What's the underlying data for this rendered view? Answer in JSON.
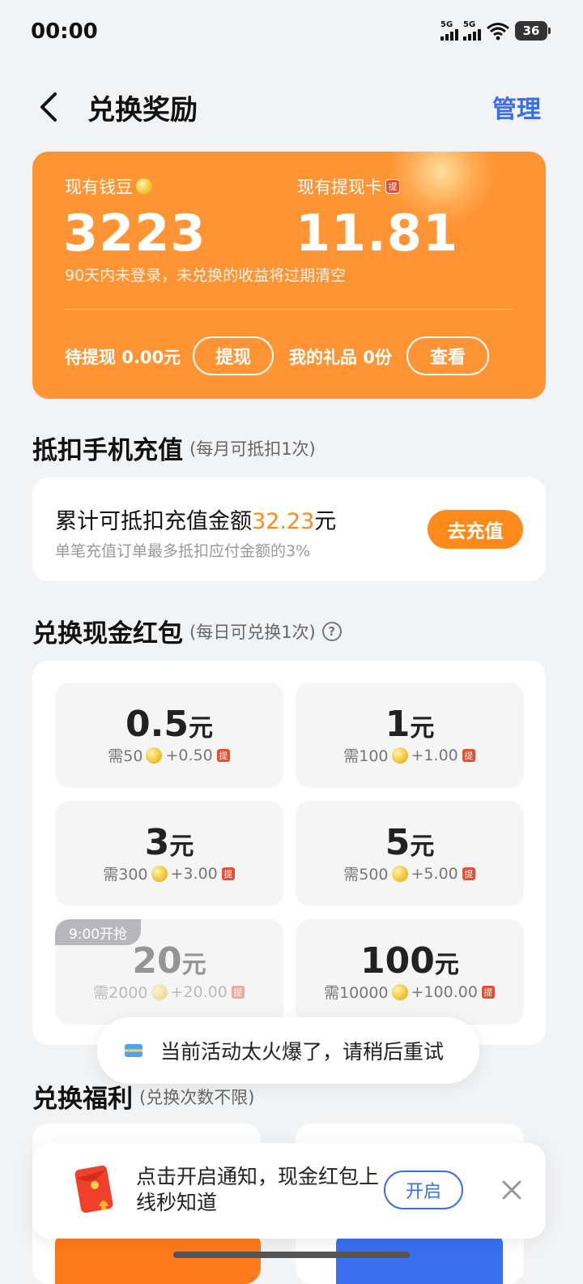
{
  "status": {
    "time": "00:00",
    "signal1": "5G",
    "signal2": "5G",
    "battery": "36"
  },
  "header": {
    "title": "兑换奖励",
    "manage": "管理"
  },
  "summary": {
    "beans_label": "现有钱豆",
    "beans_value": "3223",
    "card_label": "现有提现卡",
    "card_value": "11.81",
    "ti_glyph": "提",
    "notice": "90天内未登录，未兑换的收益将过期清空",
    "pending_label": "待提现 0.00元",
    "withdraw_btn": "提现",
    "gifts_label": "我的礼品 0份",
    "view_btn": "查看"
  },
  "recharge": {
    "title": "抵扣手机充值",
    "subtitle": "(每月可抵扣1次)",
    "main_prefix": "累计可抵扣充值金额",
    "main_amount": "32.23",
    "main_suffix": "元",
    "note": "单笔充值订单最多抵扣应付金额的3%",
    "button": "去充值"
  },
  "cash": {
    "title": "兑换现金红包",
    "subtitle": "(每日可兑换1次)",
    "help_glyph": "?",
    "items": [
      {
        "amount": "0.5",
        "unit": "元",
        "need": "需50",
        "plus": "+0.50",
        "ti": "提"
      },
      {
        "amount": "1",
        "unit": "元",
        "need": "需100",
        "plus": "+1.00",
        "ti": "提"
      },
      {
        "amount": "3",
        "unit": "元",
        "need": "需300",
        "plus": "+3.00",
        "ti": "提"
      },
      {
        "amount": "5",
        "unit": "元",
        "need": "需500",
        "plus": "+5.00",
        "ti": "提"
      },
      {
        "amount": "20",
        "unit": "元",
        "need": "需2000",
        "plus": "+20.00",
        "ti": "提",
        "tag": "9:00开抢"
      },
      {
        "amount": "100",
        "unit": "元",
        "need": "需10000",
        "plus": "+100.00",
        "ti": "提"
      }
    ]
  },
  "toast": {
    "text": "当前活动太火爆了，请稍后重试"
  },
  "welfare": {
    "title": "兑换福利",
    "subtitle": "(兑换次数不限)"
  },
  "notify": {
    "text": "点击开启通知，现金红包上线秒知道",
    "button": "开启"
  },
  "colors": {
    "orange": "#ff9434",
    "accent_blue": "#3b6df0",
    "highlight": "#ff8a1c"
  }
}
